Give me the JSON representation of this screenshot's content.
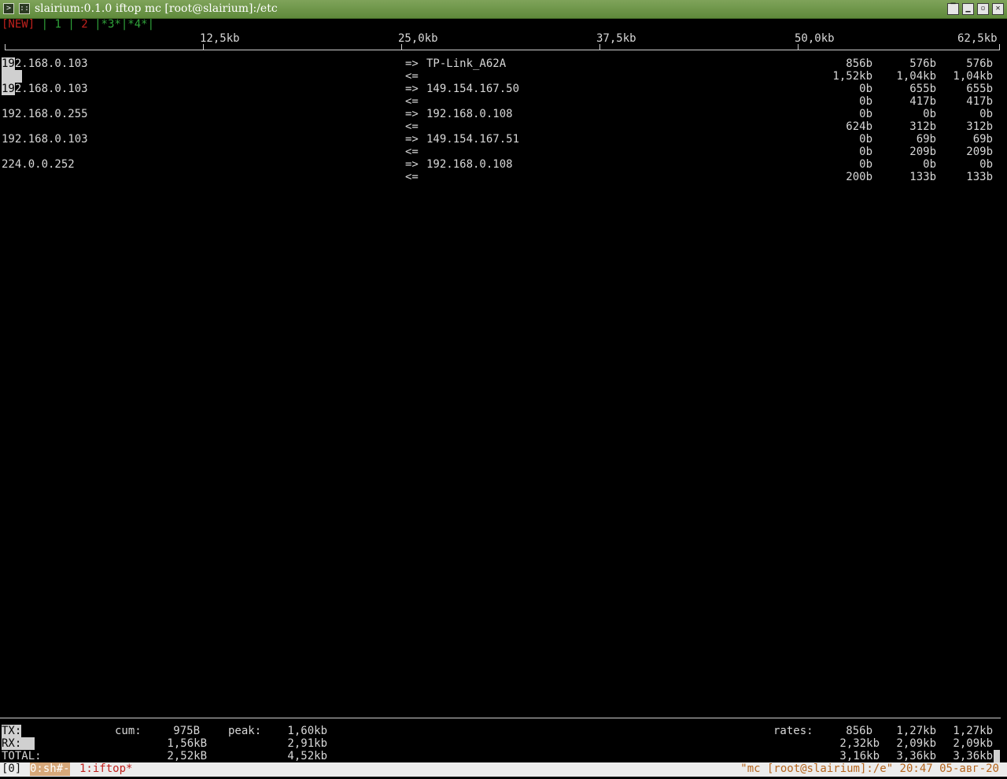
{
  "window": {
    "title": "slairium:0.1.0 iftop mc [root@slairium]:/etc",
    "icons": [
      "terminal-icon",
      "menu-icon"
    ],
    "buttons": [
      "minimize-icon",
      "iconify-icon",
      "maximize-icon",
      "close-icon"
    ]
  },
  "tabs": {
    "new": "[NEW]",
    "sep1": "|",
    "t1": "1",
    "sep2": "|",
    "t2": "2",
    "sep3": "|",
    "t3": "*3*",
    "sep4": "|",
    "t4": "*4*",
    "sep5": "|"
  },
  "scale": [
    "12,5kb",
    "25,0kb",
    "37,5kb",
    "50,0kb",
    "62,5kb"
  ],
  "connections": [
    {
      "host": "192.168.0.103",
      "out": "=>",
      "in": "<=",
      "peer": "TP-Link_A62A",
      "tx": [
        "856b",
        "576b",
        "576b"
      ],
      "rx": [
        "1,52kb",
        "1,04kb",
        "1,04kb"
      ]
    },
    {
      "host": "192.168.0.103",
      "out": "=>",
      "in": "<=",
      "peer": "149.154.167.50",
      "tx": [
        "0b",
        "655b",
        "655b"
      ],
      "rx": [
        "0b",
        "417b",
        "417b"
      ]
    },
    {
      "host": "192.168.0.255",
      "out": "=>",
      "in": "<=",
      "peer": "192.168.0.108",
      "tx": [
        "0b",
        "0b",
        "0b"
      ],
      "rx": [
        "624b",
        "312b",
        "312b"
      ]
    },
    {
      "host": "192.168.0.103",
      "out": "=>",
      "in": "<=",
      "peer": "149.154.167.51",
      "tx": [
        "0b",
        "69b",
        "69b"
      ],
      "rx": [
        "0b",
        "209b",
        "209b"
      ]
    },
    {
      "host": "224.0.0.252",
      "out": "=>",
      "in": "<=",
      "peer": "192.168.0.108",
      "tx": [
        "0b",
        "0b",
        "0b"
      ],
      "rx": [
        "200b",
        "133b",
        "133b"
      ]
    }
  ],
  "totals": {
    "tx_label": "TX:",
    "rx_label": "RX:",
    "total_label": "TOTAL:",
    "cum_label": "cum:",
    "peak_label": "peak:",
    "rates_label": "rates:",
    "cum": [
      "975B",
      "1,56kB",
      "2,52kB"
    ],
    "peak": [
      "1,60kb",
      "2,91kb",
      "4,52kb"
    ],
    "tx_rates": [
      "856b",
      "1,27kb",
      "1,27kb"
    ],
    "rx_rates": [
      "2,32kb",
      "2,09kb",
      "2,09kb"
    ],
    "total_rates": [
      "3,16kb",
      "3,36kb",
      "3,36kb"
    ]
  },
  "statusbar": {
    "session": "[0]",
    "win0": "0:sh#-",
    "win1": "1:iftop*",
    "right": "\"mc [root@slairium]:/e\" 20:47 05-авг-20"
  }
}
